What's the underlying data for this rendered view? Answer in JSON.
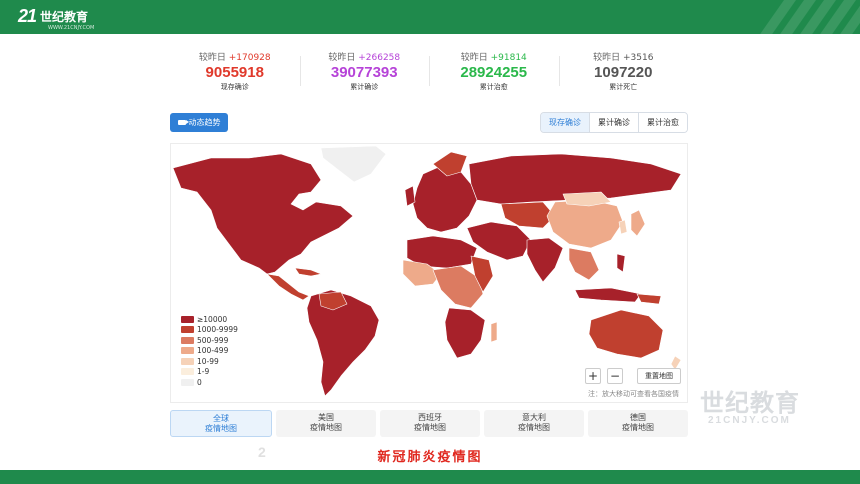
{
  "brand": {
    "mark": "21",
    "name": "世纪教育",
    "url": "WWW.21CNJY.COM"
  },
  "stats": [
    {
      "delta_label": "较昨日",
      "delta": "+170928",
      "value": "9055918",
      "label": "现存确诊",
      "color": "#e0392b"
    },
    {
      "delta_label": "较昨日",
      "delta": "+266258",
      "value": "39077393",
      "label": "累计确诊",
      "color": "#b643d8"
    },
    {
      "delta_label": "较昨日",
      "delta": "+91814",
      "value": "28924255",
      "label": "累计治愈",
      "color": "#2bb84b"
    },
    {
      "delta_label": "较昨日",
      "delta": "+3516",
      "value": "1097220",
      "label": "累计死亡",
      "color": "#555555"
    }
  ],
  "trend_button": "动态趋势",
  "map_tabs": [
    "现存确诊",
    "累计确诊",
    "累计治愈"
  ],
  "legend": [
    {
      "label": "≥10000",
      "color": "#a7212a"
    },
    {
      "label": "1000-9999",
      "color": "#c0402f"
    },
    {
      "label": "500-999",
      "color": "#dc7b61"
    },
    {
      "label": "100-499",
      "color": "#eeaa8a"
    },
    {
      "label": "10-99",
      "color": "#f6d2b8"
    },
    {
      "label": "1-9",
      "color": "#fbeedd"
    },
    {
      "label": "0",
      "color": "#f0f0f0"
    }
  ],
  "map_controls": {
    "zoom_in": "+",
    "zoom_out": "−",
    "reset": "重置地图"
  },
  "hint": "注：放大移动可查看各国疫情",
  "country_tabs": [
    {
      "line1": "全球",
      "line2": "疫情地图",
      "active": true
    },
    {
      "line1": "美国",
      "line2": "疫情地图",
      "active": false
    },
    {
      "line1": "西班牙",
      "line2": "疫情地图",
      "active": false
    },
    {
      "line1": "意大利",
      "line2": "疫情地图",
      "active": false
    },
    {
      "line1": "德国",
      "line2": "疫情地图",
      "active": false
    }
  ],
  "caption": "新冠肺炎疫情图",
  "watermark": {
    "name": "世纪教育",
    "url": "21CNJY.COM"
  },
  "page_number": "2"
}
